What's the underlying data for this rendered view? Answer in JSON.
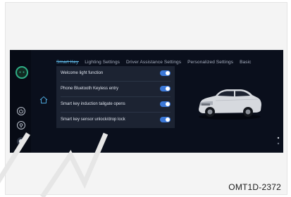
{
  "tabs": [
    {
      "label": "Smart Key",
      "active": true
    },
    {
      "label": "Lighting Settings",
      "active": false
    },
    {
      "label": "Driver Assistance Settings",
      "active": false
    },
    {
      "label": "Personalized Settings",
      "active": false
    },
    {
      "label": "Basic",
      "active": false
    }
  ],
  "settings": [
    {
      "label": "Welcome light function",
      "enabled": true
    },
    {
      "label": "Phone Bluetooth Keyless entry",
      "enabled": true
    },
    {
      "label": "Smart key induction tailgate opens",
      "enabled": true
    },
    {
      "label": "Smart key sensor unlock/drop lock",
      "enabled": true
    }
  ],
  "left_icons": [
    "avatar-icon",
    "power-icon",
    "location-icon",
    "record-icon"
  ],
  "colors": {
    "accent": "#5fb8e6",
    "toggle_on": "#3b78d8",
    "screen_bg": "#0a0f1c",
    "avatar_ring": "#2fae86"
  },
  "figure_code": "OMT1D-2372"
}
